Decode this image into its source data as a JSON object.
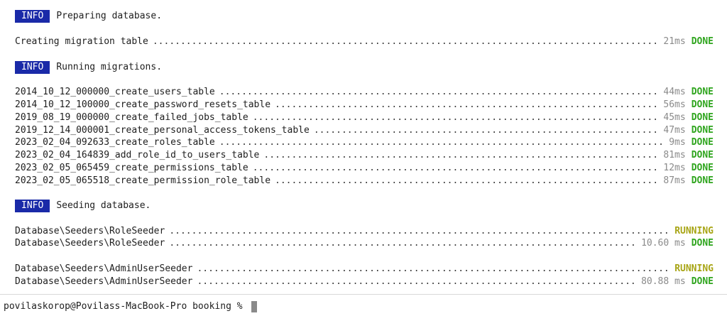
{
  "info_badge": "INFO",
  "section1": {
    "info_text": "Preparing database.",
    "rows": [
      {
        "label": "Creating migration table",
        "timing": "21ms",
        "status": "DONE"
      }
    ]
  },
  "section2": {
    "info_text": "Running migrations.",
    "rows": [
      {
        "label": "2014_10_12_000000_create_users_table",
        "timing": "44ms",
        "status": "DONE"
      },
      {
        "label": "2014_10_12_100000_create_password_resets_table",
        "timing": "56ms",
        "status": "DONE"
      },
      {
        "label": "2019_08_19_000000_create_failed_jobs_table",
        "timing": "45ms",
        "status": "DONE"
      },
      {
        "label": "2019_12_14_000001_create_personal_access_tokens_table",
        "timing": "47ms",
        "status": "DONE"
      },
      {
        "label": "2023_02_04_092633_create_roles_table",
        "timing": "9ms",
        "status": "DONE"
      },
      {
        "label": "2023_02_04_164839_add_role_id_to_users_table",
        "timing": "81ms",
        "status": "DONE"
      },
      {
        "label": "2023_02_05_065459_create_permissions_table",
        "timing": "12ms",
        "status": "DONE"
      },
      {
        "label": "2023_02_05_065518_create_permission_role_table",
        "timing": "87ms",
        "status": "DONE"
      }
    ]
  },
  "section3": {
    "info_text": "Seeding database.",
    "rows": [
      {
        "label": "Database\\Seeders\\RoleSeeder",
        "timing": "",
        "status": "RUNNING"
      },
      {
        "label": "Database\\Seeders\\RoleSeeder",
        "timing": "10.60 ms",
        "status": "DONE"
      },
      {
        "label": "Database\\Seeders\\AdminUserSeeder",
        "timing": "",
        "status": "RUNNING"
      },
      {
        "label": "Database\\Seeders\\AdminUserSeeder",
        "timing": "80.88 ms",
        "status": "DONE"
      }
    ]
  },
  "prompt": {
    "text": "povilaskorop@Povilass-MacBook-Pro booking % "
  },
  "colors": {
    "badge_bg": "#1a2aa8",
    "done": "#2fa51e",
    "running": "#a8a516",
    "timing": "#8a8a8a"
  }
}
